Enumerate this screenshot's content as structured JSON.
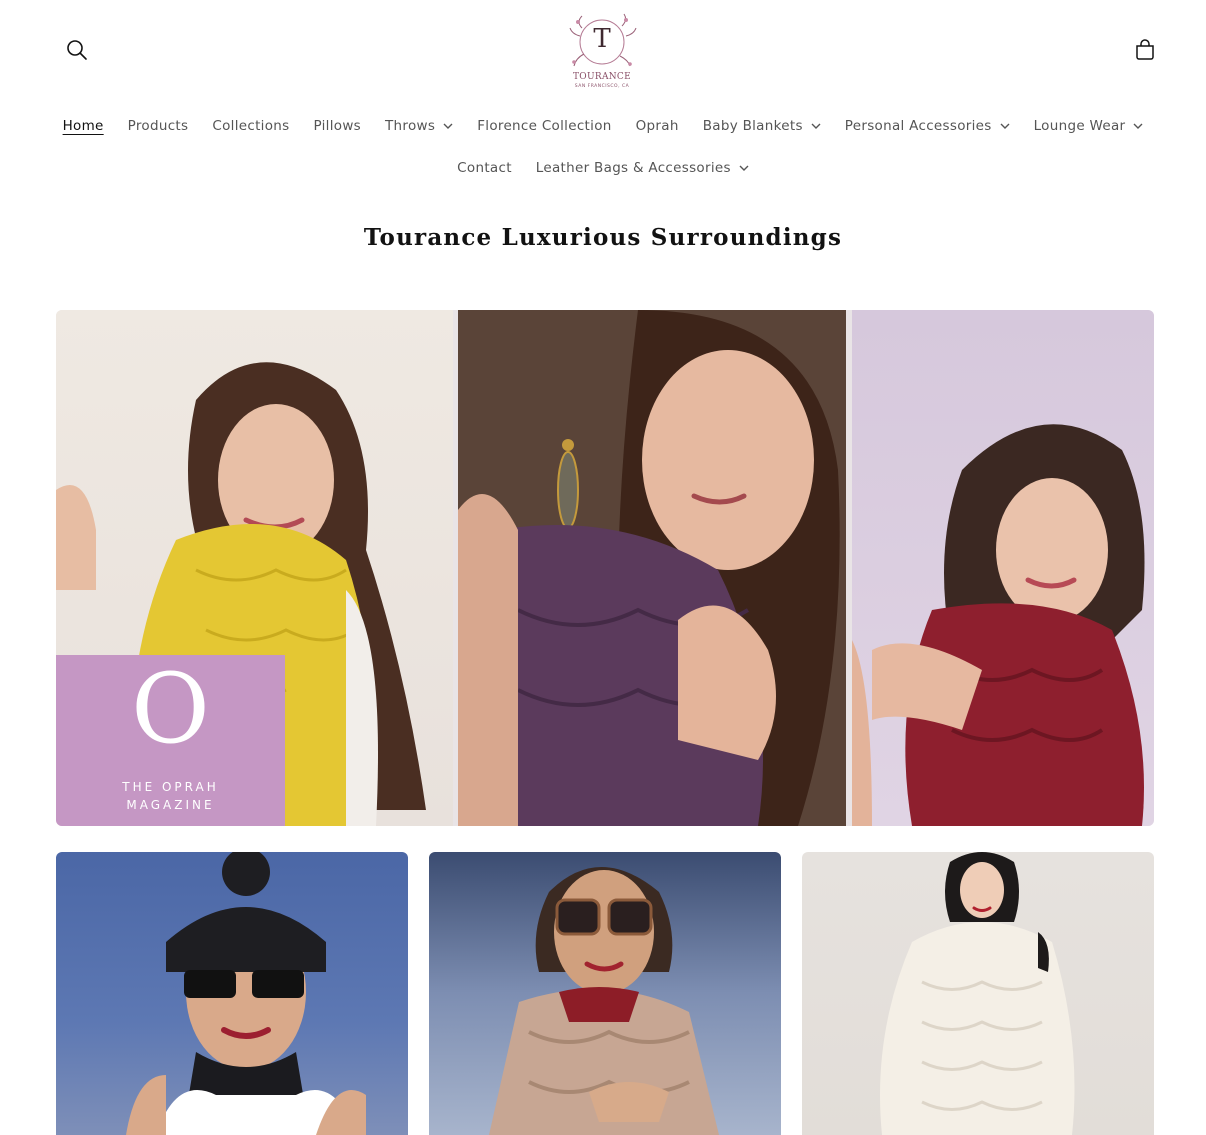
{
  "header": {
    "logo": {
      "initial": "T",
      "name": "TOURANCE",
      "location": "SAN FRANCISCO, CA"
    },
    "search_icon": "search-icon",
    "cart_icon": "cart-icon"
  },
  "nav": {
    "row1": [
      {
        "label": "Home",
        "active": true,
        "dropdown": false
      },
      {
        "label": "Products",
        "dropdown": false
      },
      {
        "label": "Collections",
        "dropdown": false
      },
      {
        "label": "Pillows",
        "dropdown": false
      },
      {
        "label": "Throws",
        "dropdown": true
      },
      {
        "label": "Florence Collection",
        "dropdown": false
      },
      {
        "label": "Oprah",
        "dropdown": false
      },
      {
        "label": "Baby Blankets",
        "dropdown": true
      },
      {
        "label": "Personal Accessories",
        "dropdown": true
      },
      {
        "label": "Lounge Wear",
        "dropdown": true
      }
    ],
    "row2": [
      {
        "label": "Contact",
        "dropdown": false
      },
      {
        "label": "Leather Bags & Accessories",
        "dropdown": true
      }
    ]
  },
  "main": {
    "title": "Tourance Luxurious Surroundings",
    "banner": {
      "badge_letter": "O",
      "badge_line1": "THE OPRAH",
      "badge_line2": "MAGAZINE",
      "badge_color": "#c597c4"
    }
  },
  "colors": {
    "accent": "#8a5068",
    "text": "#121212",
    "nav_text": "#555555"
  }
}
